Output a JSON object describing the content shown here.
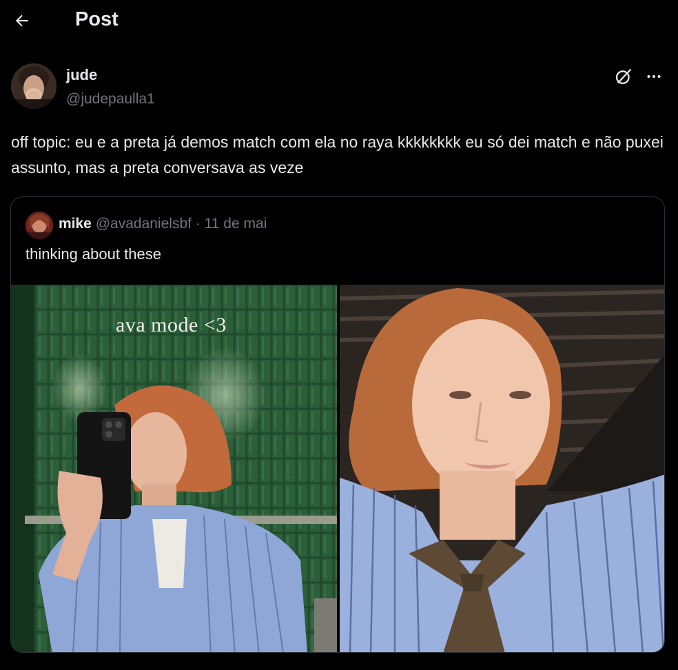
{
  "header": {
    "title": "Post",
    "back_icon": "arrow-left-icon"
  },
  "post": {
    "author": {
      "name": "jude",
      "handle": "@judepaulla1"
    },
    "text": "off topic: eu e a preta já demos match com ela no raya kkkkkkkk eu só dei match e não puxei assunto, mas a preta conversava as veze",
    "actions": {
      "grok_icon": "grok-icon",
      "more_icon": "more-icon"
    }
  },
  "quote": {
    "author": {
      "name": "mike",
      "handle": "@avadanielsbf",
      "separator": "·",
      "date": "11 de mai"
    },
    "text": "thinking about these",
    "media": [
      {
        "caption": "ava mode <3",
        "type": "mirror-selfie-photo"
      },
      {
        "type": "selfie-photo"
      }
    ]
  },
  "colors": {
    "background": "#000000",
    "text": "#e7e9ea",
    "secondary": "#71767b",
    "border": "#2f3336"
  }
}
